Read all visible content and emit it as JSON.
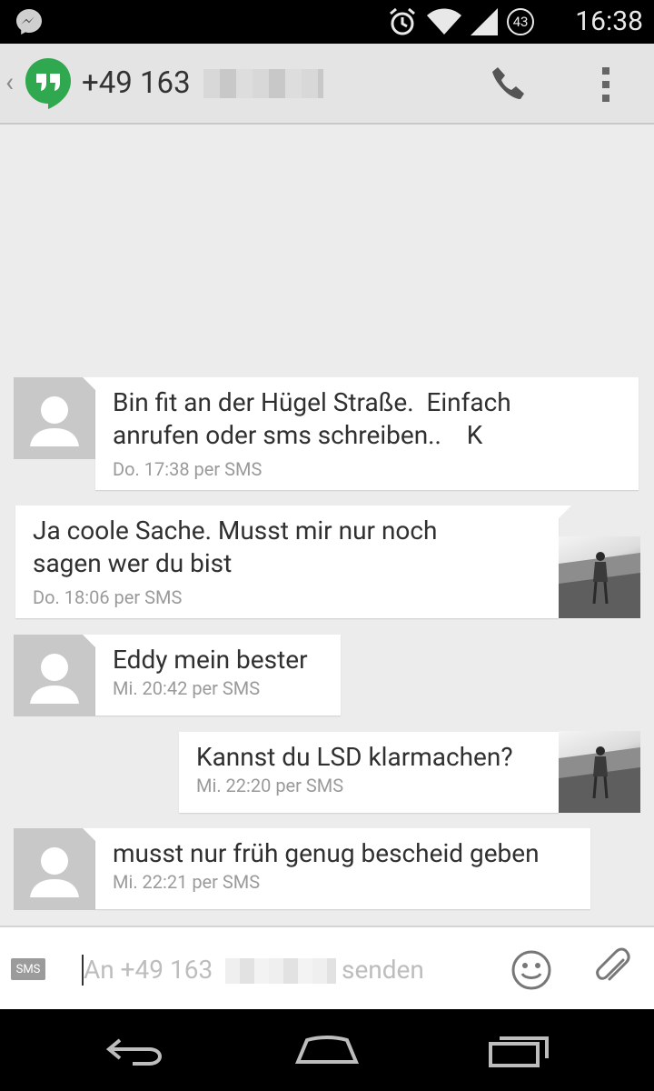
{
  "status_bar": {
    "time": "16:38",
    "notification_count": "43",
    "icons": [
      "messenger-icon",
      "alarm-icon",
      "wifi-icon",
      "signal-icon"
    ]
  },
  "action_bar": {
    "title": "+49 163",
    "icons": [
      "back-chevron-icon",
      "hangouts-logo-icon",
      "phone-icon",
      "overflow-menu-icon"
    ]
  },
  "messages": [
    {
      "direction": "incoming",
      "text": "Bin fit an der Hügel Straße.  Einfach\nanrufen oder sms schreiben..    K",
      "meta": "Do. 17:38 per SMS"
    },
    {
      "direction": "outgoing",
      "text": "Ja coole Sache. Musst mir nur noch\nsagen wer du bist",
      "meta": "Do. 18:06 per SMS"
    },
    {
      "direction": "incoming",
      "text": "Eddy mein bester",
      "meta": "Mi. 20:42 per SMS"
    },
    {
      "direction": "outgoing",
      "text": "Kannst du LSD klarmachen?",
      "meta": "Mi. 22:20 per SMS"
    },
    {
      "direction": "incoming",
      "text": "musst nur früh genug bescheid geben",
      "meta": "Mi. 22:21 per SMS"
    }
  ],
  "compose": {
    "sms_badge": "SMS",
    "placeholder_prefix": "An +49 163",
    "placeholder_suffix": "senden",
    "icons": [
      "emoji-icon",
      "attachment-icon"
    ]
  },
  "colors": {
    "accent_green": "#2fa84f",
    "background": "#ececec",
    "bubble": "#ffffff"
  }
}
